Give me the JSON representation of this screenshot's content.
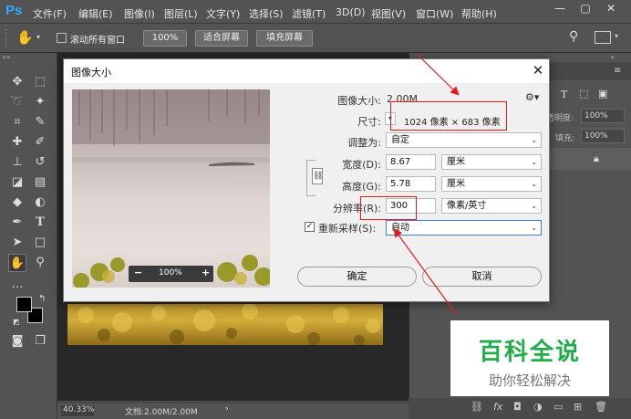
{
  "app": {
    "logo": "Ps"
  },
  "menubar": {
    "items": [
      "文件(F)",
      "编辑(E)",
      "图像(I)",
      "图层(L)",
      "文字(Y)",
      "选择(S)",
      "滤镜(T)",
      "3D(D)",
      "视图(V)",
      "窗口(W)",
      "帮助(H)"
    ]
  },
  "optionsbar": {
    "scroll_all_label": "滚动所有窗口",
    "zoom_100": "100%",
    "fit_screen": "适合屏幕",
    "fill_screen": "填充屏幕"
  },
  "right_panel": {
    "opacity_label": "透明度:",
    "opacity_value": "100%",
    "fill_label": "填充:",
    "fill_value": "100%"
  },
  "statusbar": {
    "zoom": "40.33%",
    "doc_info": "文档:2.00M/2.00M"
  },
  "dialog": {
    "title": "图像大小",
    "image_size_label": "图像大小:",
    "image_size_value": "2.00M",
    "dimensions_label": "尺寸:",
    "dimensions_value": "1024 像素 × 683 像素",
    "fit_to_label": "调整为:",
    "fit_to_value": "自定",
    "width_label": "宽度(D):",
    "width_value": "8.67",
    "width_unit": "厘米",
    "height_label": "高度(G):",
    "height_value": "5.78",
    "height_unit": "厘米",
    "resolution_label": "分辨率(R):",
    "resolution_value": "300",
    "resolution_unit": "像素/英寸",
    "resample_label": "重新采样(S):",
    "resample_checked": true,
    "resample_value": "自动",
    "preview_zoom": "100%",
    "ok": "确定",
    "cancel": "取消"
  },
  "watermark": {
    "title": "百科全说",
    "subtitle": "助你轻松解决"
  },
  "colors": {
    "annotation_red": "#e21c1c",
    "ps_blue": "#31a8ff",
    "watermark_green": "#1fae4a"
  }
}
